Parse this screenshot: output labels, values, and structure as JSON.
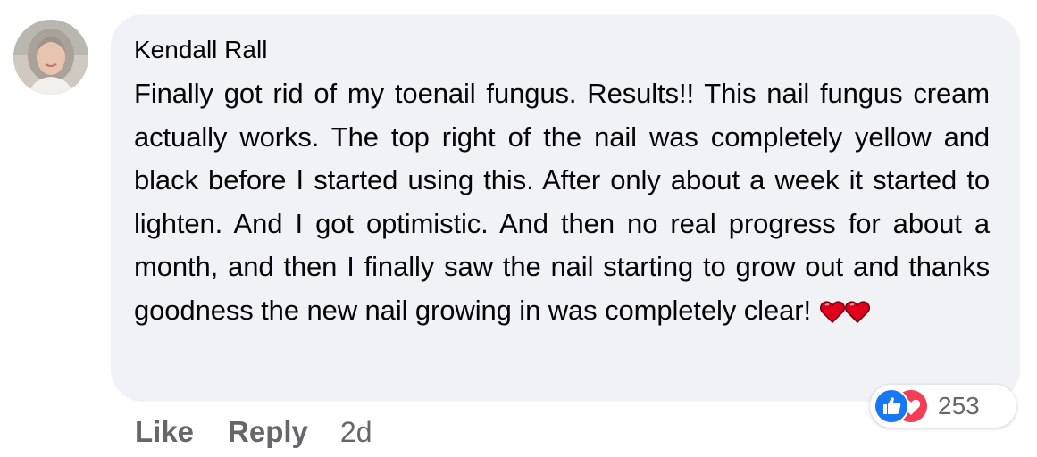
{
  "comment": {
    "author": "Kendall Rall",
    "text": "Finally got rid of my toenail fungus. Results!! This nail fungus cream actually works. The top right of the nail was completely yellow and black before I started using this. After only about a week it started to lighten. And I got optimistic. And then no real progress for about a month, and then I finally saw the nail starting to grow out and thanks goodness the new nail growing in was completely clear!",
    "emoji": [
      "red-heart-icon",
      "red-heart-icon"
    ]
  },
  "reactions": {
    "icons": [
      "like-icon",
      "love-icon"
    ],
    "count": "253"
  },
  "actions": {
    "like_label": "Like",
    "reply_label": "Reply",
    "timestamp": "2d"
  },
  "colors": {
    "bubble": "#f0f2f5",
    "text": "#050505",
    "secondary_text": "#65676b",
    "like_blue": "#1877f2",
    "love_red": "#f33e58",
    "heart_red": "#e0001b"
  }
}
